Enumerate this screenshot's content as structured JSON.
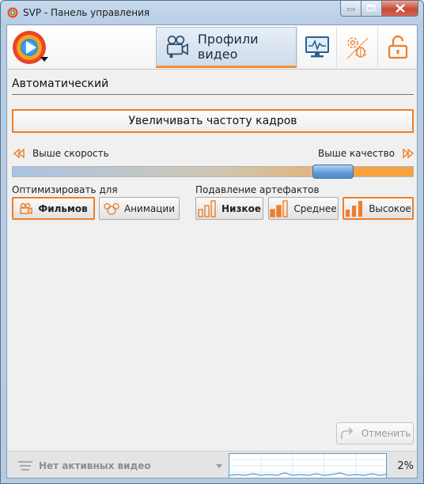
{
  "window": {
    "title": "SVP - Панель управления"
  },
  "topbar": {
    "profiles_tab_label": "Профили видео",
    "icons": [
      "svp-logo-icon",
      "video-camera-icon",
      "monitor-icon",
      "settings-bug-icon",
      "unlock-icon"
    ]
  },
  "profile": {
    "name": "Автоматический",
    "main_button": "Увеличивать частоту кадров"
  },
  "slider": {
    "left_label": "Выше скорость",
    "right_label": "Выше качество",
    "value": 0.84
  },
  "optimize": {
    "label": "Оптимизировать для",
    "options": [
      {
        "label": "Фильмов",
        "icon": "video-camera-icon",
        "selected": true
      },
      {
        "label": "Анимации",
        "icon": "mouse-ears-icon",
        "selected": false
      }
    ]
  },
  "artifacts": {
    "label": "Подавление артефактов",
    "options": [
      {
        "label": "Низкое",
        "icon": "bars-icon",
        "selected": false
      },
      {
        "label": "Среднее",
        "icon": "bars-icon",
        "selected": false
      },
      {
        "label": "Высокое",
        "icon": "bars-icon",
        "selected": true
      }
    ]
  },
  "undo": {
    "label": "Отменить"
  },
  "status": {
    "text": "Нет активных видео",
    "cpu_percent": "2%"
  },
  "colors": {
    "accent": "#f07d26",
    "thumb": "#5f9ad6"
  }
}
